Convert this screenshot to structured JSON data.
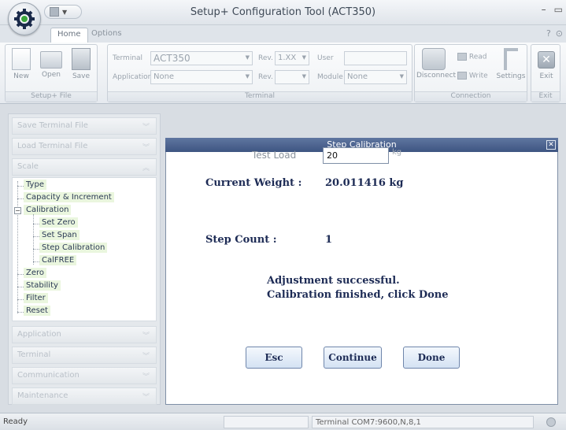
{
  "window": {
    "title": "Setup+ Configuration Tool (ACT350)"
  },
  "tabs": {
    "home": "Home",
    "options": "Options"
  },
  "ribbon": {
    "setup_file": {
      "group_label": "Setup+ File",
      "new": "New",
      "open": "Open",
      "save": "Save"
    },
    "terminal": {
      "group_label": "Terminal",
      "terminal_label": "Terminal",
      "terminal_value": "ACT350",
      "rev_label": "Rev.",
      "rev_value": "1.XX",
      "user_label": "User",
      "user_value": "",
      "application_label": "Application",
      "application_value": "None",
      "rev2_label": "Rev.",
      "rev2_value": "",
      "module_label": "Module",
      "module_value": "None"
    },
    "connection": {
      "group_label": "Connection",
      "disconnect": "Disconnect",
      "read": "Read",
      "write": "Write",
      "settings": "Settings"
    },
    "exit": {
      "group_label": "Exit",
      "exit": "Exit"
    }
  },
  "sidebar": {
    "headers": {
      "save_terminal_file": "Save Terminal File",
      "load_terminal_file": "Load Terminal File",
      "scale": "Scale",
      "application": "Application",
      "terminal": "Terminal",
      "communication": "Communication",
      "maintenance": "Maintenance"
    },
    "tree": {
      "type": "Type",
      "capacity": "Capacity & Increment",
      "calibration": "Calibration",
      "set_zero": "Set Zero",
      "set_span": "Set Span",
      "step_calibration": "Step Calibration",
      "calfree": "CalFREE",
      "zero": "Zero",
      "stability": "Stability",
      "filter": "Filter",
      "reset": "Reset"
    }
  },
  "dialog": {
    "title": "Step Calibration",
    "test_load_label": "Test Load",
    "test_load_value": "20",
    "test_load_unit": "kg",
    "current_weight_label": "Current Weight :",
    "current_weight_value": "20.011416 kg",
    "step_count_label": "Step Count :",
    "step_count_value": "1",
    "message_line1": "Adjustment successful.",
    "message_line2": "Calibration finished, click Done",
    "buttons": {
      "esc": "Esc",
      "continue": "Continue",
      "done": "Done"
    }
  },
  "statusbar": {
    "status": "Ready",
    "terminal_label": "Terminal",
    "connection": "COM7:9600,N,8,1"
  }
}
